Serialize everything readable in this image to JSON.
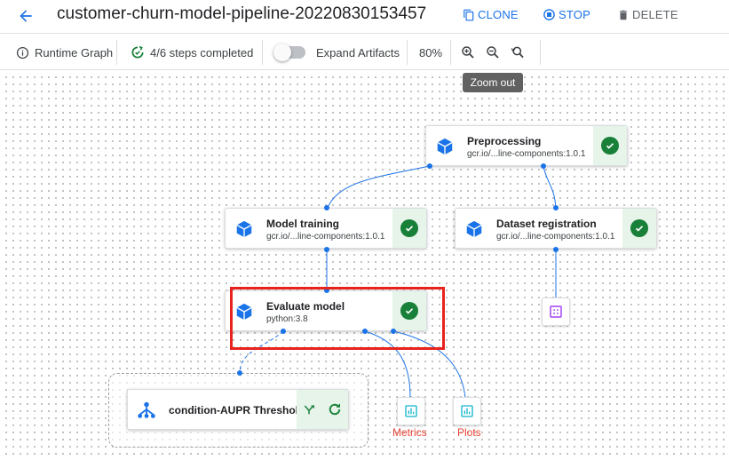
{
  "header": {
    "title": "customer-churn-model-pipeline-20220830153457",
    "clone_label": "CLONE",
    "stop_label": "STOP",
    "delete_label": "DELETE"
  },
  "toolbar": {
    "runtime_graph_label": "Runtime Graph",
    "steps_label": "4/6 steps completed",
    "expand_artifacts_label": "Expand Artifacts",
    "expand_artifacts_on": false,
    "zoom_level": "80%"
  },
  "tooltip": {
    "text": "Zoom out"
  },
  "nodes": {
    "preprocessing": {
      "name": "Preprocessing",
      "sub": "gcr.io/...line-components:1.0.1",
      "status": "succeeded"
    },
    "model_training": {
      "name": "Model training",
      "sub": "gcr.io/...line-components:1.0.1",
      "status": "succeeded"
    },
    "dataset_registration": {
      "name": "Dataset registration",
      "sub": "gcr.io/...line-components:1.0.1",
      "status": "succeeded"
    },
    "evaluate_model": {
      "name": "Evaluate model",
      "sub": "python:3.8",
      "status": "succeeded"
    },
    "condition": {
      "name": "condition-AUPR Threshol...",
      "status": "running"
    }
  },
  "artifacts": {
    "metrics_label": "Metrics",
    "plots_label": "Plots"
  },
  "colors": {
    "accent": "#1a73e8",
    "success": "#188038",
    "success_bg": "#e6f4ea",
    "highlight": "#e8231e",
    "artifact_label": "#ea4335",
    "dataset_icon": "#a142f4",
    "metrics_icon": "#12b5cb"
  }
}
